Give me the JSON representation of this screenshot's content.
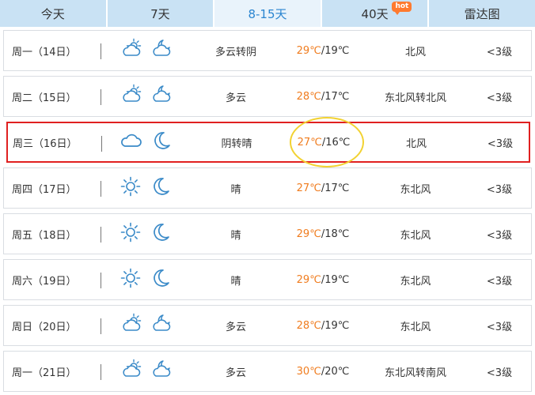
{
  "tabs": [
    {
      "label": "今天"
    },
    {
      "label": "7天"
    },
    {
      "label": "8-15天",
      "active": true
    },
    {
      "label": "40天",
      "badge": "hot"
    },
    {
      "label": "雷达图"
    }
  ],
  "days": [
    {
      "date": "周一（14日）",
      "day_icon": "partly-cloudy-sun-icon",
      "night_icon": "cloudy-moon-icon",
      "desc": "多云转阴",
      "high": "29℃",
      "low": "/19℃",
      "wind": "北风",
      "level": "<3级"
    },
    {
      "date": "周二（15日）",
      "day_icon": "partly-cloudy-sun-icon",
      "night_icon": "cloudy-moon-icon",
      "desc": "多云",
      "high": "28℃",
      "low": "/17℃",
      "wind": "东北风转北风",
      "level": "<3级"
    },
    {
      "date": "周三（16日）",
      "day_icon": "cloud-icon",
      "night_icon": "moon-icon",
      "desc": "阴转晴",
      "high": "27℃",
      "low": "/16℃",
      "wind": "北风",
      "level": "<3级"
    },
    {
      "date": "周四（17日）",
      "day_icon": "sun-icon",
      "night_icon": "moon-icon",
      "desc": "晴",
      "high": "27℃",
      "low": "/17℃",
      "wind": "东北风",
      "level": "<3级"
    },
    {
      "date": "周五（18日）",
      "day_icon": "sun-icon",
      "night_icon": "moon-icon",
      "desc": "晴",
      "high": "29℃",
      "low": "/18℃",
      "wind": "东北风",
      "level": "<3级"
    },
    {
      "date": "周六（19日）",
      "day_icon": "sun-icon",
      "night_icon": "moon-icon",
      "desc": "晴",
      "high": "29℃",
      "low": "/19℃",
      "wind": "东北风",
      "level": "<3级"
    },
    {
      "date": "周日（20日）",
      "day_icon": "partly-cloudy-sun-icon",
      "night_icon": "cloudy-moon-icon",
      "desc": "多云",
      "high": "28℃",
      "low": "/19℃",
      "wind": "东北风",
      "level": "<3级"
    },
    {
      "date": "周一（21日）",
      "day_icon": "partly-cloudy-sun-icon",
      "night_icon": "cloudy-moon-icon",
      "desc": "多云",
      "high": "30℃",
      "low": "/20℃",
      "wind": "东北风转南风",
      "level": "<3级"
    }
  ],
  "colors": {
    "tab_bg": "#c9e2f4",
    "tab_active_text": "#2a85d0",
    "high_temp": "#f07c1e",
    "highlight_border": "#e02020",
    "circle": "#f2d232",
    "icon_stroke": "#3a8ac8"
  }
}
